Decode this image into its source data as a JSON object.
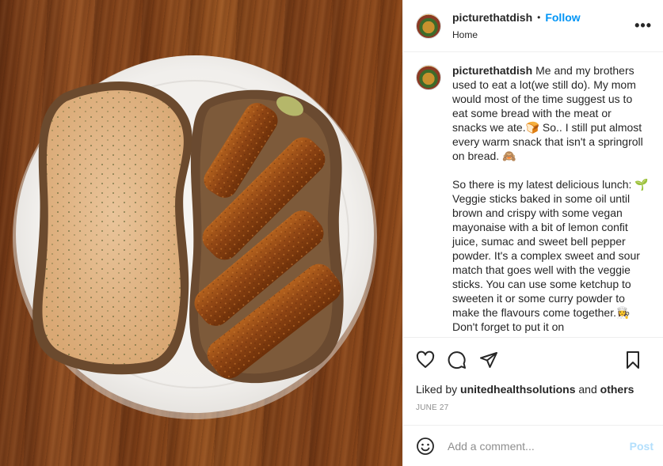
{
  "header": {
    "username": "picturethatdish",
    "separator": "•",
    "follow_label": "Follow",
    "location": "Home",
    "more_label": "•••"
  },
  "caption": {
    "username": "picturethatdish",
    "paragraph1": "Me and my brothers used to eat a lot(we still do). My mom would most of the time suggest us to eat some bread with the meat or snacks we ate.🍞 So.. I still put almost every warm snack that isn't a springroll on bread. 🙈",
    "paragraph2": "So there is my latest delicious lunch: 🌱Veggie sticks baked in some oil until brown and crispy with some vegan mayonaise with a bit of lemon confit juice, sumac and sweet bell pepper powder. It's a complex sweet and sour match that goes well with the veggie sticks. You can use some ketchup to sweeten it or some curry powder to make the flavours come together.👩‍🍳 Don't forget to put it on"
  },
  "actions": {
    "like_icon": "heart-icon",
    "comment_icon": "comment-bubble-icon",
    "share_icon": "paper-plane-icon",
    "save_icon": "bookmark-icon"
  },
  "likes": {
    "prefix": "Liked by ",
    "user": "unitedhealthsolutions",
    "conjunction": " and ",
    "others": "others"
  },
  "date": "JUNE 27",
  "comment_box": {
    "placeholder": "Add a comment...",
    "post_label": "Post",
    "emoji_icon": "smiley-icon"
  },
  "colors": {
    "link_blue": "#0095f6",
    "post_disabled": "#b3dffc",
    "muted_gray": "#8e8e8e",
    "border": "#efefef",
    "wood": "#7b3d17"
  }
}
